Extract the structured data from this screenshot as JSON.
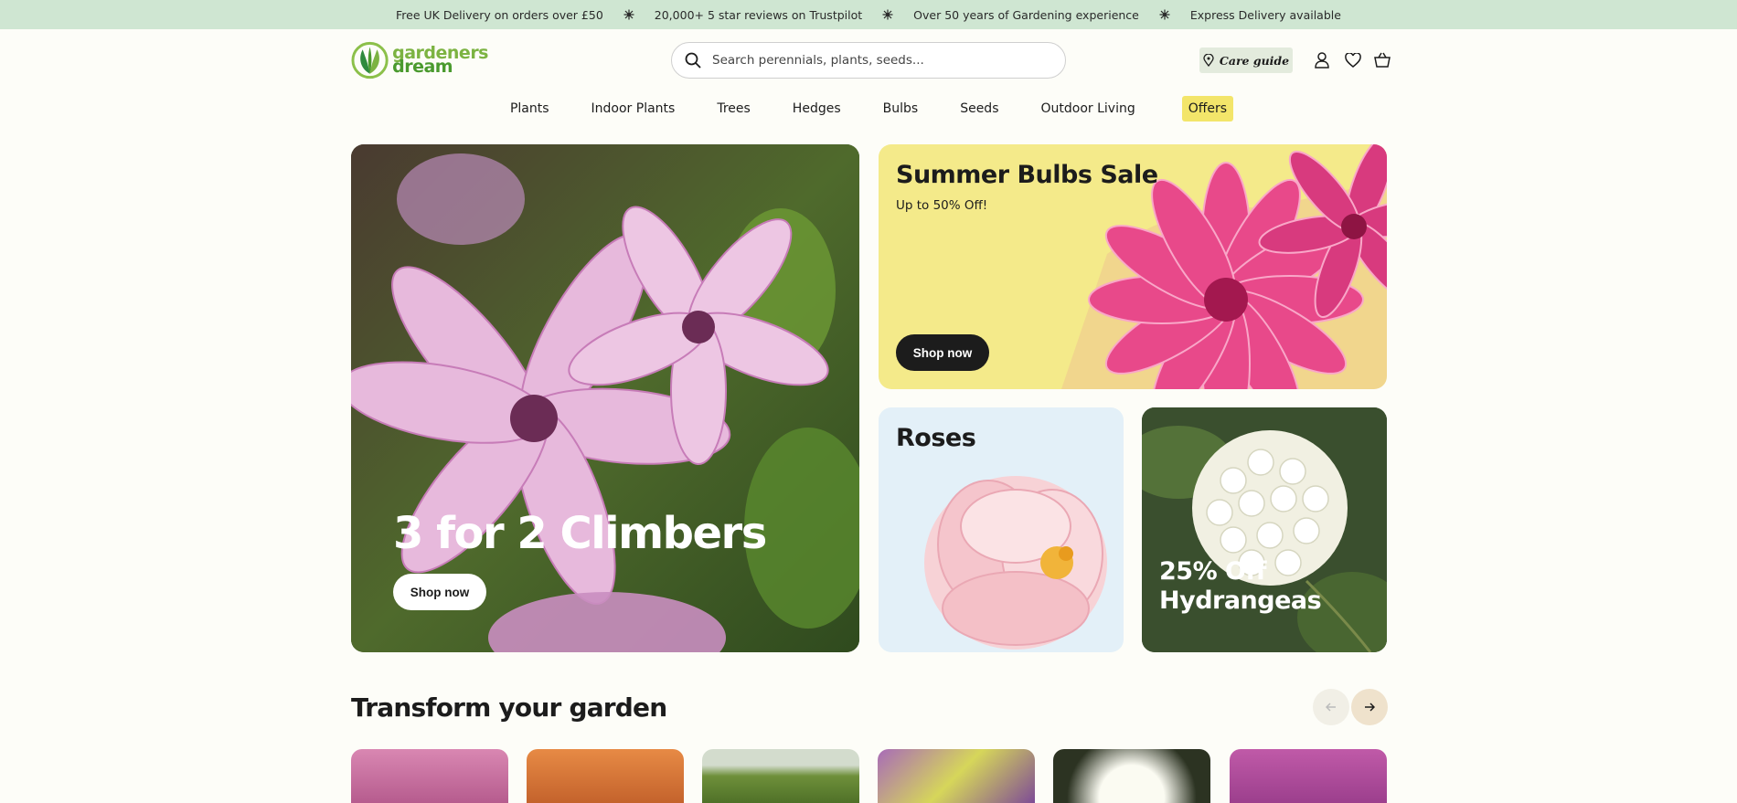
{
  "promo_bar": {
    "items": [
      "Free UK Delivery on orders over £50",
      "20,000+ 5 star reviews on Trustpilot",
      "Over 50 years of Gardening experience",
      "Express Delivery available"
    ]
  },
  "logo": {
    "line1": "gardeners",
    "line2": "dream"
  },
  "search": {
    "placeholder": "Search perennials, plants, seeds..."
  },
  "header": {
    "care_guide_label": "Care guide"
  },
  "nav": {
    "items": [
      "Plants",
      "Indoor Plants",
      "Trees",
      "Hedges",
      "Bulbs",
      "Seeds",
      "Outdoor Living",
      "Offers"
    ]
  },
  "hero": {
    "title": "3 for 2 Climbers",
    "button": "Shop now"
  },
  "bulbs_promo": {
    "title": "Summer Bulbs Sale",
    "subtitle": "Up to 50% Off!",
    "button": "Shop now"
  },
  "roses_promo": {
    "title": "Roses"
  },
  "hydrangea_promo": {
    "title": "25% Off Hydrangeas"
  },
  "section": {
    "title": "Transform your garden"
  },
  "carousel": {
    "prev_icon": "arrow-left-icon",
    "next_icon": "arrow-right-icon"
  },
  "colors": {
    "promo_bar": "#cfe6d2",
    "offers_highlight": "#f3e56a",
    "bulbs_bg": "#f4ea8a",
    "roses_bg": "#e3f0f8",
    "brand_green": "#4a9a2e"
  }
}
